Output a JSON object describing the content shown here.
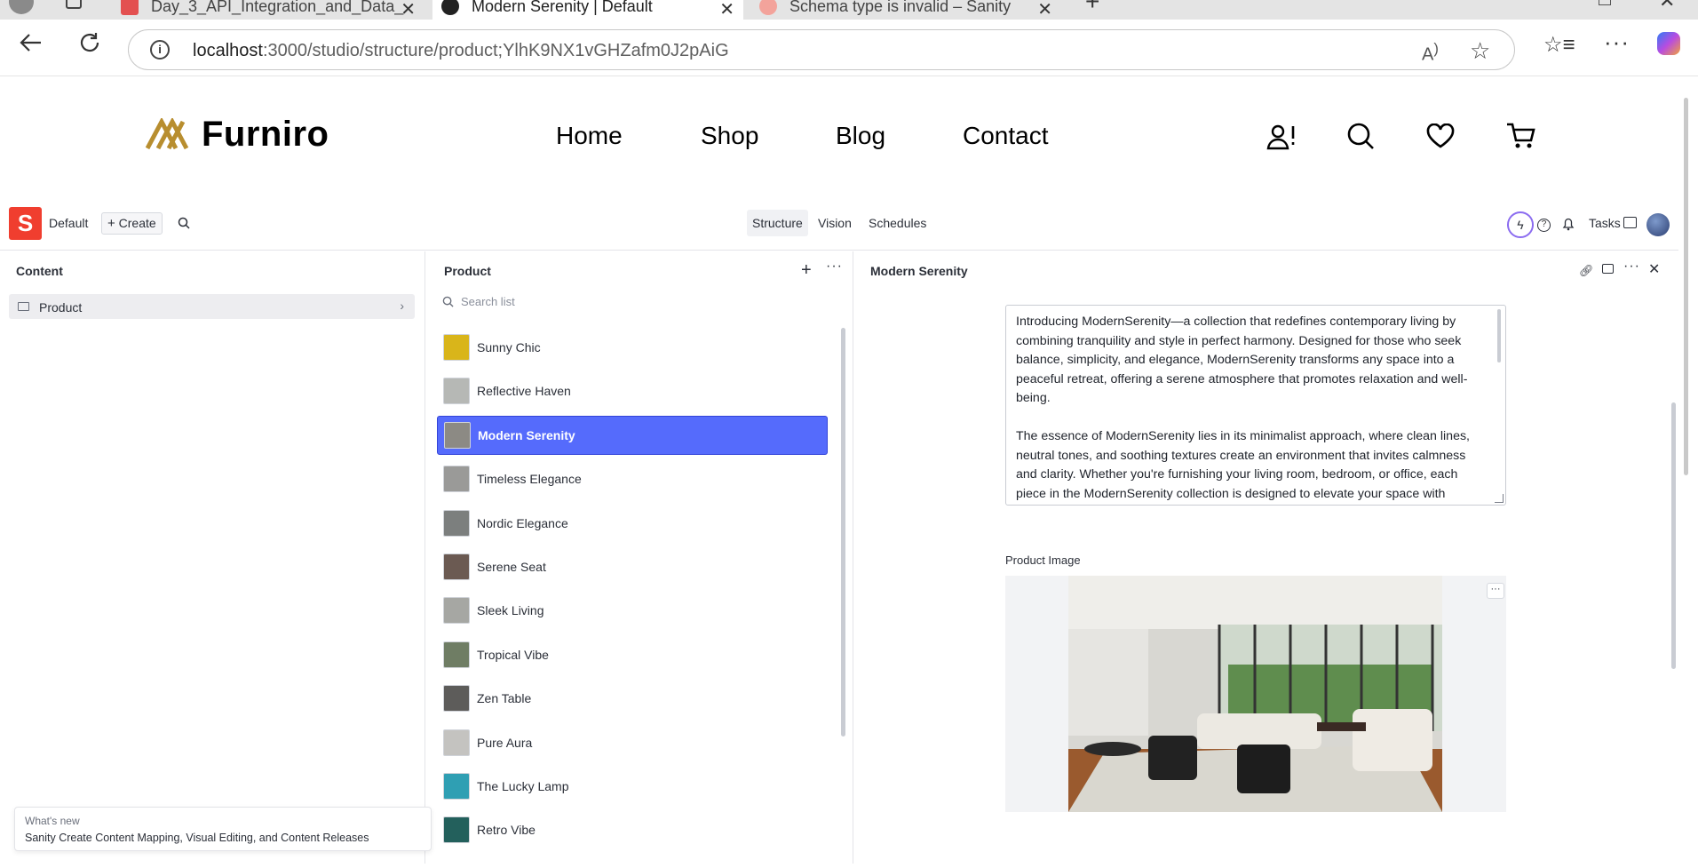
{
  "browser": {
    "tabs": [
      {
        "label": "Day_3_API_Integration_and_Data_"
      },
      {
        "label": "Modern Serenity | Default"
      },
      {
        "label": "Schema type is invalid – Sanity"
      }
    ],
    "url_host": "localhost",
    "url_path": ":3000/studio/structure/product;YlhK9NX1vGHZafm0J2pAiG"
  },
  "site": {
    "brand": "Furniro",
    "nav": [
      "Home",
      "Shop",
      "Blog",
      "Contact"
    ]
  },
  "studio": {
    "workspace": "Default",
    "logo_letter": "S",
    "create_label": "Create",
    "tools": [
      "Structure",
      "Vision",
      "Schedules"
    ],
    "tasks_label": "Tasks",
    "content_pane": {
      "title": "Content",
      "items": [
        {
          "label": "Product"
        }
      ]
    },
    "product_pane": {
      "title": "Product",
      "search_placeholder": "Search list",
      "items": [
        {
          "label": "Sunny Chic",
          "color": "#d9b51a"
        },
        {
          "label": "Reflective Haven",
          "color": "#b6b8b5"
        },
        {
          "label": "Modern Serenity",
          "color": "#8c8a84"
        },
        {
          "label": "Timeless Elegance",
          "color": "#9a9a98"
        },
        {
          "label": "Nordic Elegance",
          "color": "#7c7f7e"
        },
        {
          "label": "Serene Seat",
          "color": "#6b5a52"
        },
        {
          "label": "Sleek Living",
          "color": "#a6a7a3"
        },
        {
          "label": "Tropical Vibe",
          "color": "#6f7d64"
        },
        {
          "label": "Zen Table",
          "color": "#5d5c5a"
        },
        {
          "label": "Pure Aura",
          "color": "#c4c3c0"
        },
        {
          "label": "The Lucky Lamp",
          "color": "#2f9fb3"
        },
        {
          "label": "Retro Vibe",
          "color": "#23605c"
        }
      ],
      "selected_index": 2
    },
    "document": {
      "title": "Modern Serenity",
      "description_paragraphs": [
        "Introducing ModernSerenity—a collection that redefines contemporary living by combining tranquility and style in perfect harmony. Designed for those who seek balance, simplicity, and elegance, ModernSerenity transforms any space into a peaceful retreat, offering a serene atmosphere that promotes relaxation and well-being.",
        "The essence of ModernSerenity lies in its minimalist approach, where clean lines, neutral tones, and soothing textures create an environment that invites calmness and clarity. Whether you're furnishing your living room, bedroom, or office, each piece in the ModernSerenity collection is designed to elevate your space with understated luxury and effortless sophistication."
      ],
      "image_label": "Product Image"
    },
    "whats_new": {
      "heading": "What's new",
      "text": "Sanity Create Content Mapping, Visual Editing, and Content Releases"
    }
  },
  "colors": {
    "accent": "#556bfc",
    "sanity_red": "#f03e2f",
    "brand_gold": "#b88e2f"
  }
}
